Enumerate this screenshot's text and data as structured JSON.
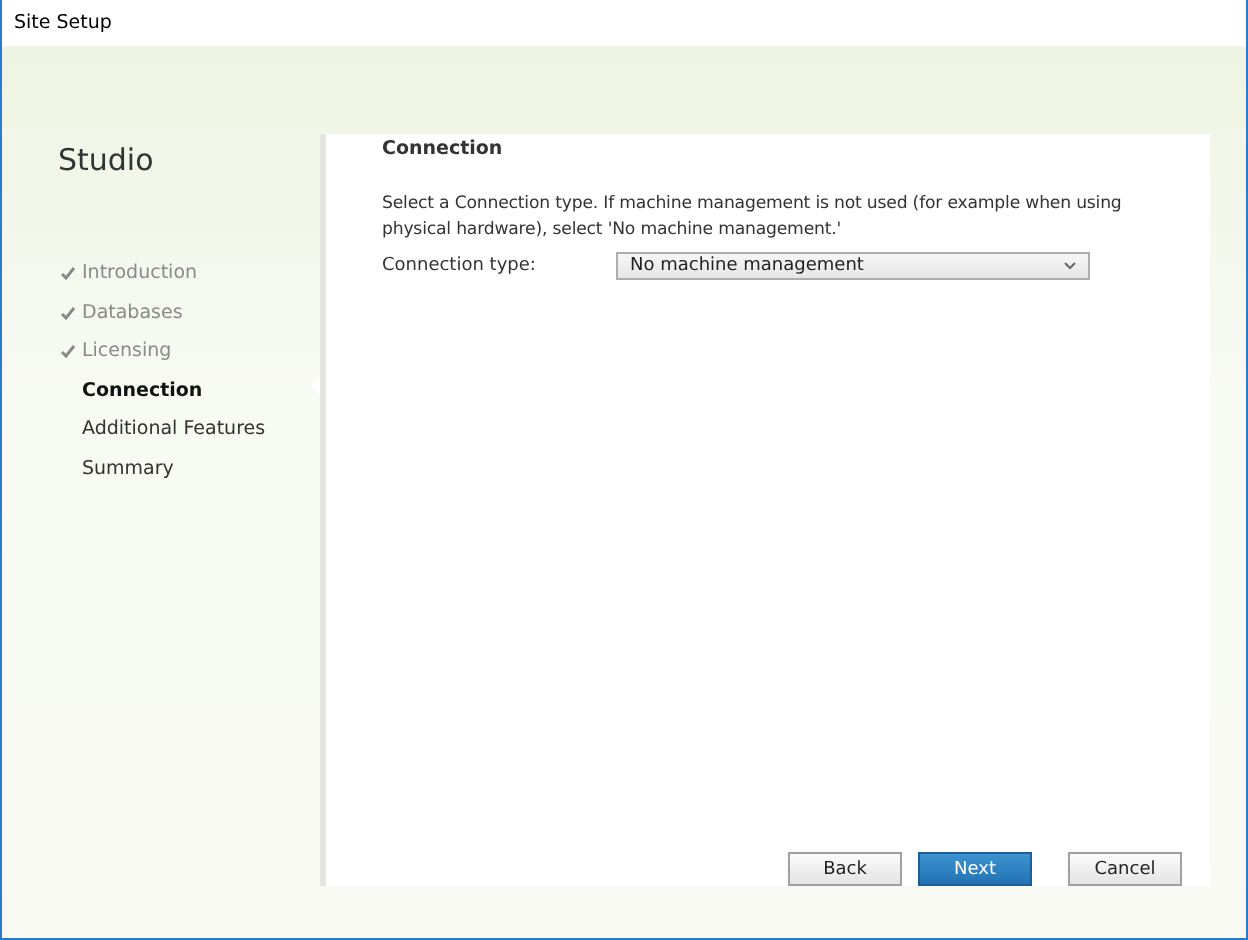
{
  "window": {
    "title": "Site Setup"
  },
  "sidebar": {
    "title": "Studio",
    "steps": [
      {
        "label": "Introduction",
        "completed": true,
        "selected": false
      },
      {
        "label": "Databases",
        "completed": true,
        "selected": false
      },
      {
        "label": "Licensing",
        "completed": true,
        "selected": false
      },
      {
        "label": "Connection",
        "completed": false,
        "selected": true
      },
      {
        "label": "Additional Features",
        "completed": false,
        "selected": false
      },
      {
        "label": "Summary",
        "completed": false,
        "selected": false
      }
    ]
  },
  "page": {
    "heading": "Connection",
    "description": "Select a Connection type. If machine management is not used (for example when using physical hardware), select 'No machine management.'",
    "field": {
      "label": "Connection type:",
      "value": "No machine management"
    }
  },
  "buttons": [
    {
      "label": "Back",
      "primary": false
    },
    {
      "label": "Next",
      "primary": true
    },
    {
      "label": "Cancel",
      "primary": false
    }
  ]
}
